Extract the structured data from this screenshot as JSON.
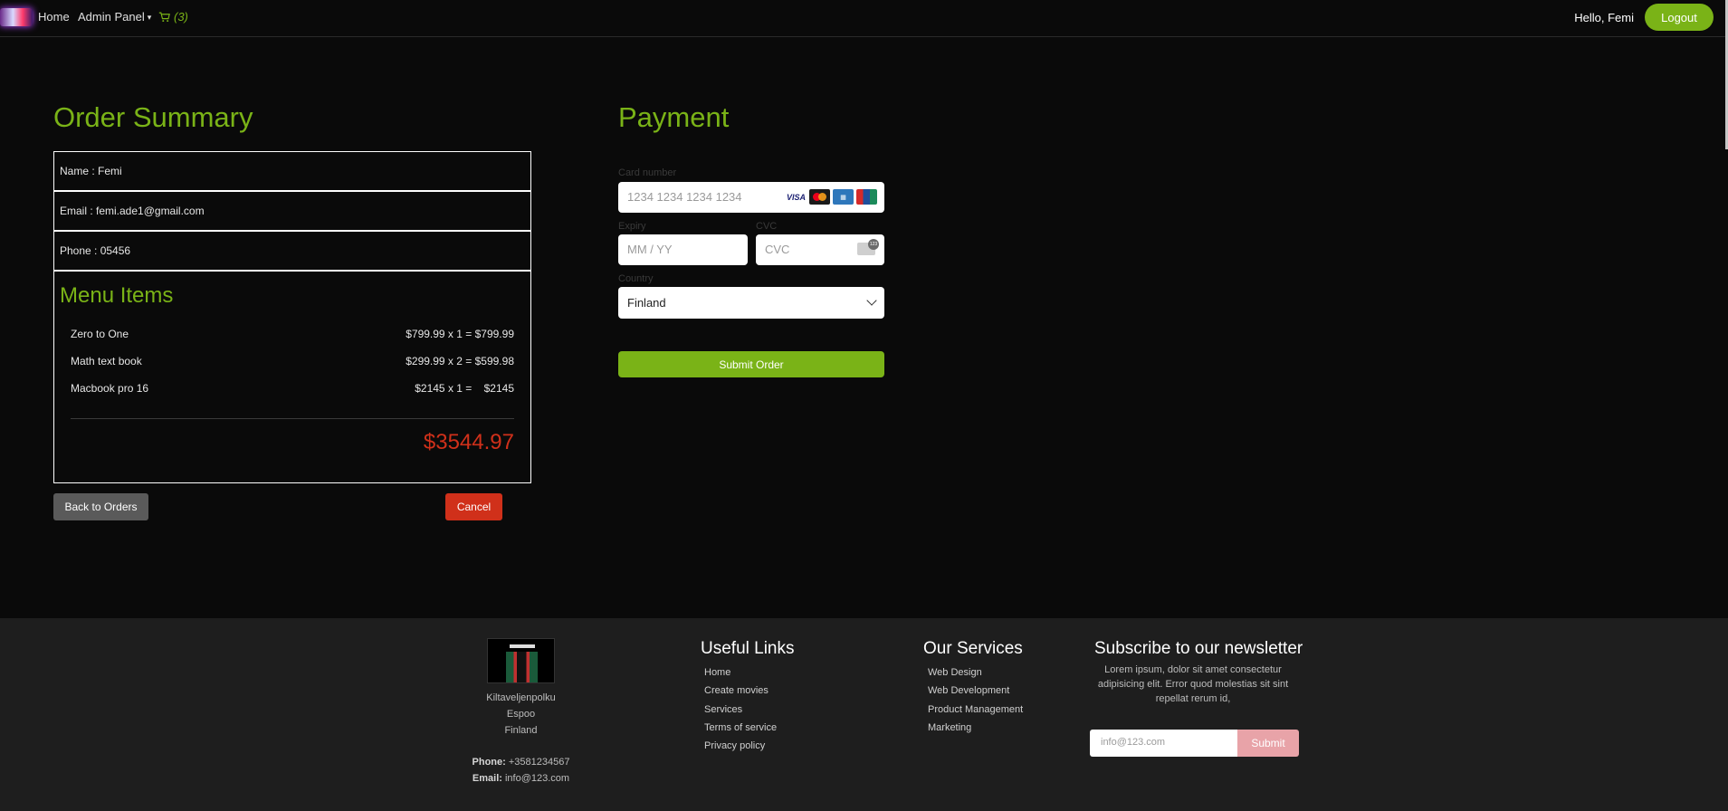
{
  "nav": {
    "home": "Home",
    "admin_panel": "Admin Panel",
    "cart_count": "(3)",
    "greeting": "Hello, Femi",
    "logout": "Logout"
  },
  "order_summary": {
    "title": "Order Summary",
    "name": "Name : Femi",
    "email": "Email : femi.ade1@gmail.com",
    "phone": "Phone : 05456",
    "menu_title": "Menu Items",
    "items": [
      {
        "name": "Zero to One",
        "price": "$799.99 x 1 = $799.99"
      },
      {
        "name": "Math text book",
        "price": "$299.99 x 2 = $599.98"
      },
      {
        "name": "Macbook pro 16",
        "price": "$2145 x 1 =    $2145"
      }
    ],
    "total": "$3544.97",
    "back_button": "Back to Orders",
    "cancel_button": "Cancel"
  },
  "payment": {
    "title": "Payment",
    "card_label": "Card number",
    "card_placeholder": "1234 1234 1234 1234",
    "expiry_label": "Expiry",
    "expiry_placeholder": "MM / YY",
    "cvc_label": "CVC",
    "cvc_placeholder": "CVC",
    "country_label": "Country",
    "country_value": "Finland",
    "card_brands": [
      "VISA",
      "mastercard-icon",
      "amex-icon",
      "unionpay-icon"
    ],
    "submit": "Submit Order"
  },
  "footer": {
    "address": [
      "Kiltaveljenpolku",
      "Espoo",
      "Finland"
    ],
    "phone_label": "Phone:",
    "phone_value": "+3581234567",
    "email_label": "Email:",
    "email_value": "info@123.com",
    "useful_links_title": "Useful Links",
    "useful_links": [
      "Home",
      "Create movies",
      "Services",
      "Terms of service",
      "Privacy policy"
    ],
    "services_title": "Our Services",
    "services": [
      "Web Design",
      "Web Development",
      "Product Management",
      "Marketing"
    ],
    "newsletter_title": "Subscribe to our newsletter",
    "newsletter_text": "Lorem ipsum, dolor sit amet consectetur adipisicing elit. Error quod molestias sit sint repellat rerum id,",
    "newsletter_placeholder": "info@123.com",
    "newsletter_submit": "Submit"
  },
  "colors": {
    "accent": "#7ab317",
    "danger": "#d0301a",
    "background": "#0a0a0a",
    "footer_bg": "#1e1e1e"
  }
}
